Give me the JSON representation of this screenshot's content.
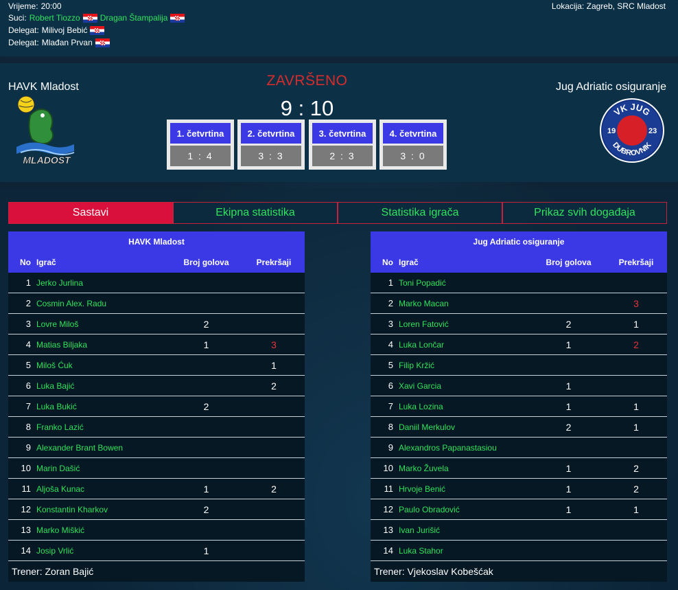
{
  "info": {
    "time_label": "Vrijeme:",
    "time_value": "20:00",
    "referees_label": "Suci:",
    "referee1": "Robert Tiozzo",
    "referee2": "Dragan Štampalija",
    "delegate1_label": "Delegat:",
    "delegate1": "Milivoj Bebić",
    "delegate2_label": "Delegat:",
    "delegate2": "Mlađan Prvan",
    "location_label": "Lokacija:",
    "location_value": "Zagreb, SRC Mladost"
  },
  "match": {
    "status": "ZAVRŠENO",
    "score": "9 : 10",
    "home_team": "HAVK Mladost",
    "away_team": "Jug Adriatic osiguranje",
    "home_logo_text": "MLADOST",
    "away_logo_top": "VK JUG",
    "away_logo_left": "19",
    "away_logo_right": "23",
    "away_logo_bottom": "DUBROVNIK",
    "quarters": [
      {
        "label": "1. četvrtina",
        "score": "1 : 4"
      },
      {
        "label": "2. četvrtina",
        "score": "3 : 3"
      },
      {
        "label": "3. četvrtina",
        "score": "2 : 3"
      },
      {
        "label": "4. četvrtina",
        "score": "3 : 0"
      }
    ]
  },
  "tabs": [
    {
      "label": "Sastavi",
      "active": true
    },
    {
      "label": "Ekipna statistika",
      "active": false
    },
    {
      "label": "Statistika igrača",
      "active": false
    },
    {
      "label": "Prikaz svih događaja",
      "active": false
    }
  ],
  "columns": {
    "no": "No",
    "player": "Igrač",
    "goals": "Broj golova",
    "fouls": "Prekršaji"
  },
  "home_lineup": {
    "team": "HAVK Mladost",
    "coach": "Trener: Zoran Bajić",
    "players": [
      {
        "no": "1",
        "name": "Jerko Jurlina",
        "goals": "",
        "fouls": ""
      },
      {
        "no": "2",
        "name": "Cosmin Alex. Radu",
        "goals": "",
        "fouls": ""
      },
      {
        "no": "3",
        "name": "Lovre Miloš",
        "goals": "2",
        "fouls": ""
      },
      {
        "no": "4",
        "name": "Matias Biljaka",
        "goals": "1",
        "fouls": "3",
        "fouls_red": true
      },
      {
        "no": "5",
        "name": "Miloš Ćuk",
        "goals": "",
        "fouls": "1"
      },
      {
        "no": "6",
        "name": "Luka Bajić",
        "goals": "",
        "fouls": "2"
      },
      {
        "no": "7",
        "name": "Luka Bukić",
        "goals": "2",
        "fouls": ""
      },
      {
        "no": "8",
        "name": "Franko Lazić",
        "goals": "",
        "fouls": ""
      },
      {
        "no": "9",
        "name": "Alexander Brant Bowen",
        "goals": "",
        "fouls": ""
      },
      {
        "no": "10",
        "name": "Marin Dašić",
        "goals": "",
        "fouls": ""
      },
      {
        "no": "11",
        "name": "Aljoša Kunac",
        "goals": "1",
        "fouls": "2"
      },
      {
        "no": "12",
        "name": "Konstantin Kharkov",
        "goals": "2",
        "fouls": ""
      },
      {
        "no": "13",
        "name": "Marko Miškić",
        "goals": "",
        "fouls": ""
      },
      {
        "no": "14",
        "name": "Josip Vrlić",
        "goals": "1",
        "fouls": ""
      }
    ]
  },
  "away_lineup": {
    "team": "Jug Adriatic osiguranje",
    "coach": "Trener: Vjekoslav Kobešćak",
    "players": [
      {
        "no": "1",
        "name": "Toni Popadić",
        "goals": "",
        "fouls": ""
      },
      {
        "no": "2",
        "name": "Marko Macan",
        "goals": "",
        "fouls": "3",
        "fouls_red": true
      },
      {
        "no": "3",
        "name": "Loren Fatović",
        "goals": "2",
        "fouls": "1"
      },
      {
        "no": "4",
        "name": "Luka Lončar",
        "goals": "1",
        "fouls": "2",
        "fouls_red": true
      },
      {
        "no": "5",
        "name": "Filip Kržić",
        "goals": "",
        "fouls": ""
      },
      {
        "no": "6",
        "name": "Xavi Garcia",
        "goals": "1",
        "fouls": ""
      },
      {
        "no": "7",
        "name": "Luka Lozina",
        "goals": "1",
        "fouls": "1"
      },
      {
        "no": "8",
        "name": "Daniil Merkulov",
        "goals": "2",
        "fouls": "1"
      },
      {
        "no": "9",
        "name": "Alexandros Papanastasiou",
        "goals": "",
        "fouls": ""
      },
      {
        "no": "10",
        "name": "Marko Žuvela",
        "goals": "1",
        "fouls": "2"
      },
      {
        "no": "11",
        "name": "Hrvoje Benić",
        "goals": "1",
        "fouls": "2"
      },
      {
        "no": "12",
        "name": "Paulo Obradović",
        "goals": "1",
        "fouls": "1"
      },
      {
        "no": "13",
        "name": "Ivan Jurišić",
        "goals": "",
        "fouls": ""
      },
      {
        "no": "14",
        "name": "Luka Stahor",
        "goals": "",
        "fouls": ""
      }
    ]
  },
  "colors": {
    "accent_blue": "#3b39e6",
    "active_tab": "#d90f3c",
    "link_green": "#2fe35c",
    "status_red": "#d82c2c",
    "foul_red": "#e3343a"
  }
}
